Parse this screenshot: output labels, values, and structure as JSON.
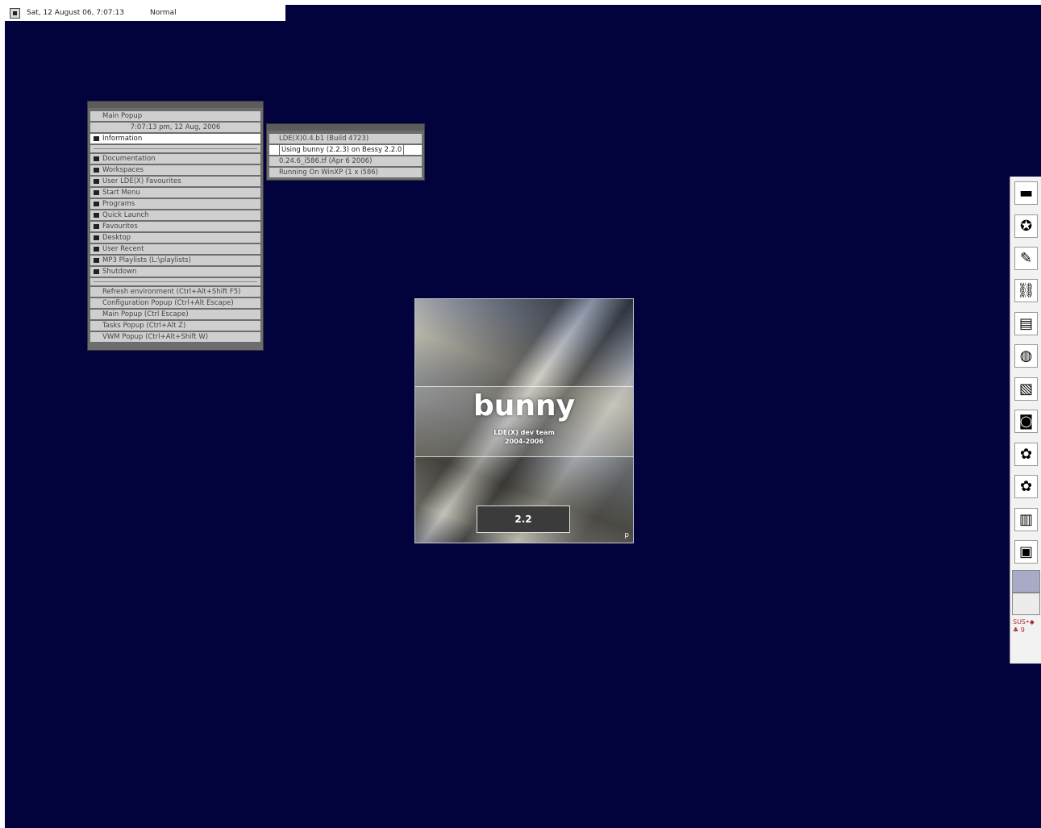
{
  "topbar": {
    "datetime": "Sat, 12 August 06, 7:07:13",
    "mode": "Normal"
  },
  "main_menu": {
    "title": "Main Popup",
    "timestamp": "7:07:13 pm, 12 Aug, 2006",
    "selected": "Information",
    "folders": [
      "Documentation",
      "Workspaces",
      "User LDE(X) Favourites",
      "Start Menu",
      "Programs",
      "Quick Launch",
      "Favourites",
      "Desktop",
      "User Recent",
      "MP3 Playlists (L:\\playlists)",
      "Shutdown"
    ],
    "actions": [
      "Refresh environment (Ctrl+Alt+Shift F5)",
      "Configuration Popup (Ctrl+Alt Escape)",
      "Main Popup (Ctrl Escape)",
      "Tasks Popup (Ctrl+Alt Z)",
      "VWM Popup (Ctrl+Alt+Shift W)"
    ]
  },
  "info_submenu": {
    "items": [
      "LDE(X)0.4.b1 (Build 4723)",
      "Using bunny (2.2.3) on Bessy 2.2.0",
      "0.24.6_i586.tf (Apr 6 2006)",
      "Running On WinXP (1 x i586)"
    ]
  },
  "splash": {
    "title": "bunny",
    "team": "LDE(X) dev team",
    "years": "2004-2006",
    "version": "2.2",
    "corner": "p"
  },
  "dock": {
    "icons": [
      "monitor-icon",
      "lifebuoy-icon",
      "wrench-icon",
      "link-icon",
      "scanner-icon",
      "globe-icon",
      "map-icon",
      "camera-icon",
      "gimp-icon",
      "gimp2-icon",
      "clipboard-icon",
      "drive-icon"
    ],
    "glyphs": [
      "▬",
      "✪",
      "✎",
      "⛓",
      "▤",
      "◍",
      "▧",
      "◙",
      "✿",
      "✿",
      "▥",
      "▣"
    ],
    "tray_text": "SUS•◆♣ 9"
  }
}
